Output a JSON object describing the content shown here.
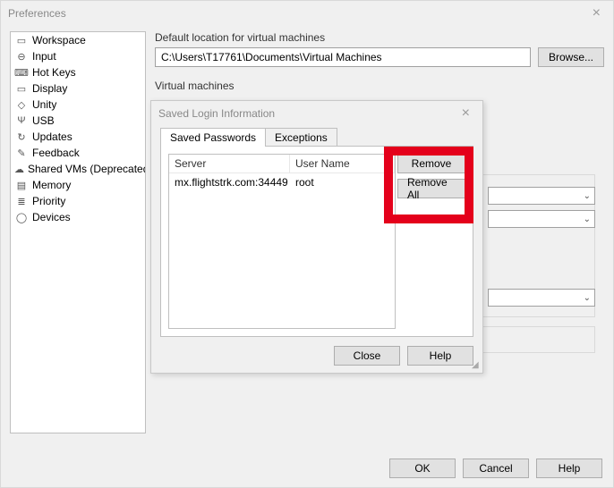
{
  "window": {
    "title": "Preferences",
    "close": "×"
  },
  "sidebar": {
    "items": [
      {
        "icon": "▭",
        "label": "Workspace"
      },
      {
        "icon": "⊖",
        "label": "Input"
      },
      {
        "icon": "⌨",
        "label": "Hot Keys"
      },
      {
        "icon": "▭",
        "label": "Display"
      },
      {
        "icon": "◇",
        "label": "Unity"
      },
      {
        "icon": "Ψ",
        "label": "USB"
      },
      {
        "icon": "↻",
        "label": "Updates"
      },
      {
        "icon": "✎",
        "label": "Feedback"
      },
      {
        "icon": "☁",
        "label": "Shared VMs (Deprecated)"
      },
      {
        "icon": "▤",
        "label": "Memory"
      },
      {
        "icon": "≣",
        "label": "Priority"
      },
      {
        "icon": "◯",
        "label": "Devices"
      }
    ]
  },
  "main": {
    "default_location_label": "Default location for virtual machines",
    "default_location_value": "C:\\Users\\T17761\\Documents\\Virtual Machines",
    "browse_label": "Browse...",
    "virtual_machines_label": "Virtual machines"
  },
  "buttons": {
    "ok": "OK",
    "cancel": "Cancel",
    "help": "Help"
  },
  "modal": {
    "title": "Saved Login Information",
    "close": "×",
    "tabs": {
      "saved_passwords": "Saved Passwords",
      "exceptions": "Exceptions"
    },
    "columns": {
      "server": "Server",
      "username": "User Name"
    },
    "rows": [
      {
        "server": "mx.flightstrk.com:34449",
        "username": "root"
      }
    ],
    "remove": "Remove",
    "remove_all": "Remove All",
    "close_btn": "Close",
    "help_btn": "Help"
  }
}
